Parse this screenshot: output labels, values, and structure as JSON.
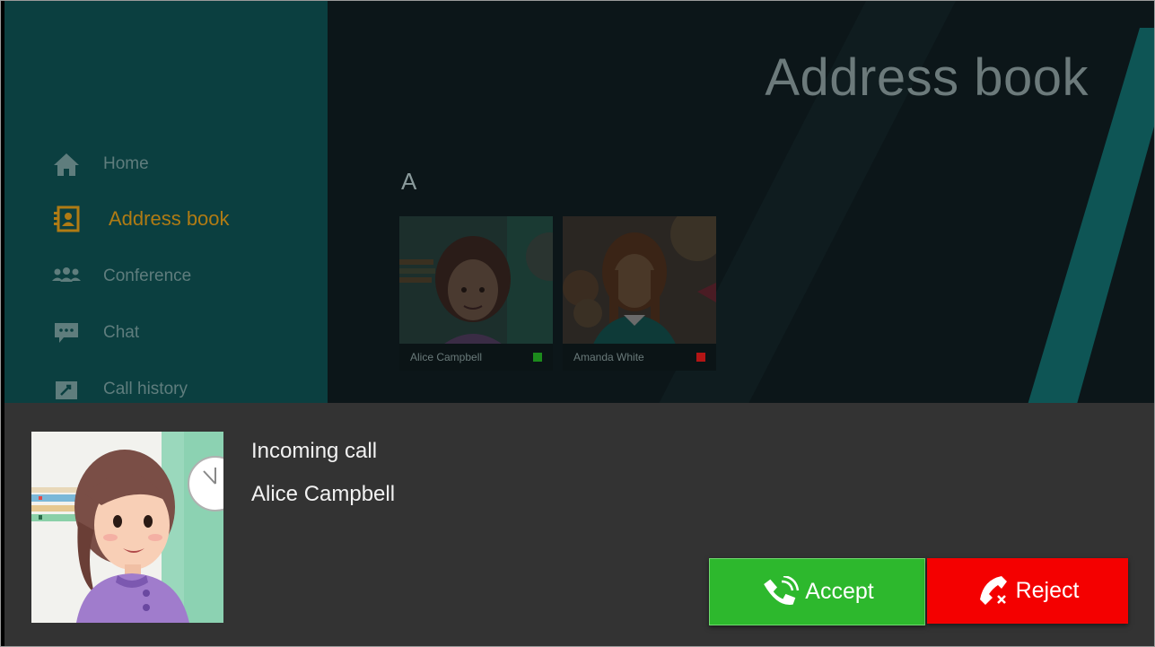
{
  "main": {
    "title": "Address book",
    "section_letter": "A",
    "contacts": [
      {
        "name": "Alice Campbell",
        "status": "online",
        "status_color": "#1c8a1c"
      },
      {
        "name": "Amanda White",
        "status": "busy",
        "status_color": "#b31515"
      }
    ]
  },
  "sidebar": {
    "items": [
      {
        "label": "Home",
        "icon": "home-icon",
        "active": false
      },
      {
        "label": "Address book",
        "icon": "address-book-icon",
        "active": true
      },
      {
        "label": "Conference",
        "icon": "conference-icon",
        "active": false
      },
      {
        "label": "Chat",
        "icon": "chat-icon",
        "active": false
      },
      {
        "label": "Call history",
        "icon": "call-history-icon",
        "active": false
      }
    ]
  },
  "incoming_call": {
    "title": "Incoming call",
    "caller": "Alice Campbell",
    "accept_label": "Accept",
    "reject_label": "Reject"
  },
  "colors": {
    "sidebar_bg": "#0b3f40",
    "main_bg": "#0c1619",
    "accent_active": "#b07b14",
    "panel_bg": "#333333",
    "accept": "#2db82d",
    "reject": "#f40000"
  }
}
